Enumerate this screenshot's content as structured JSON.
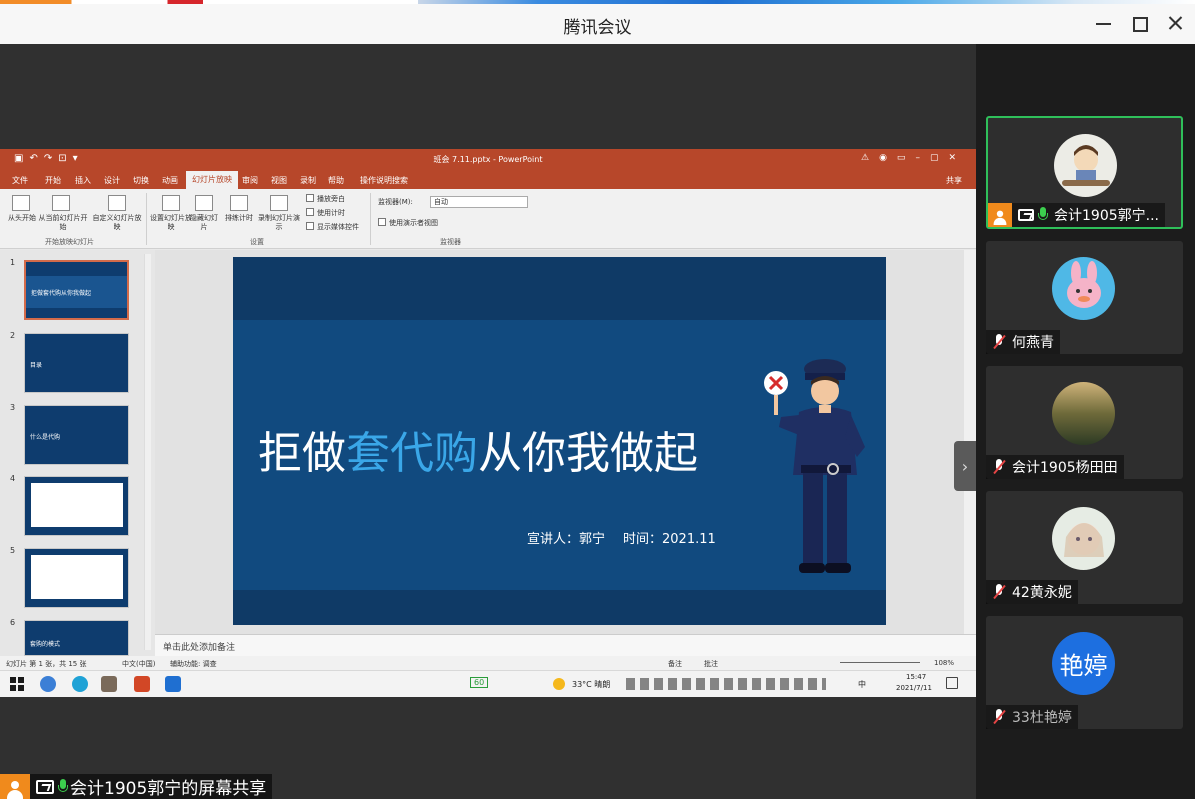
{
  "window": {
    "title": "腾讯会议"
  },
  "powerpoint": {
    "file_title": "班会 7.11.pptx - PowerPoint",
    "tabs": [
      "文件",
      "开始",
      "插入",
      "设计",
      "切换",
      "动画",
      "幻灯片放映",
      "审阅",
      "视图",
      "录制",
      "帮助",
      "操作说明搜索"
    ],
    "active_tab": "幻灯片放映",
    "share_label": "共享",
    "ribbon": {
      "from_start": "从头开始",
      "from_current": "从当前幻灯片开始",
      "custom_show": "自定义幻灯片放映",
      "group_start": "开始放映幻灯片",
      "setup": "设置幻灯片放映",
      "hide": "隐藏幻灯片",
      "rehearse": "排练计时",
      "record": "录制幻灯片演示",
      "play_narration": "播放旁白",
      "use_timings": "使用计时",
      "show_media": "显示媒体控件",
      "group_setup": "设置",
      "monitor_label": "监视器(M):",
      "monitor_value": "自动",
      "presenter_view": "使用演示者视图",
      "group_monitor": "监视器"
    },
    "thumb_numbers": [
      "1",
      "2",
      "3",
      "4",
      "5",
      "6"
    ],
    "thumb_texts": [
      "拒做套代购从你我做起",
      "目录",
      "什么是代购",
      "",
      "",
      "套购的模式"
    ],
    "slide": {
      "title_part1": "拒做",
      "title_highlight": "套代购",
      "title_part2": "从你我做起",
      "speaker": "宣讲人：郭宁",
      "time": "时间：2021.11"
    },
    "notes_placeholder": "单击此处添加备注",
    "status": {
      "slide_count": "幻灯片 第 1 张，共 15 张",
      "language": "中文(中国)",
      "accessibility": "辅助功能: 调查",
      "notes": "备注",
      "comments": "批注",
      "zoom": "108%"
    }
  },
  "taskbar": {
    "battery": "60",
    "weather": "33°C  晴朗",
    "ime": "中",
    "time": "15:47",
    "date": "2021/7/11"
  },
  "share_label": "会计1905郭宁的屏幕共享",
  "participants": [
    {
      "name": "会计1905郭宁...",
      "muted": false,
      "active": true
    },
    {
      "name": "何燕青",
      "muted": true,
      "active": false
    },
    {
      "name": "会计1905杨田田",
      "muted": true,
      "active": false
    },
    {
      "name": "42黄永妮",
      "muted": true,
      "active": false
    },
    {
      "name": "33杜艳婷",
      "muted": true,
      "active": false,
      "avatar_text": "艳婷"
    }
  ],
  "colors": {
    "ppt_accent": "#b7472a",
    "slide_bg": "#0f3a66",
    "title_highlight": "#3aa7e8",
    "active_speaker_border": "#2fbf5a",
    "avatar_orange": "#f08a1c"
  }
}
